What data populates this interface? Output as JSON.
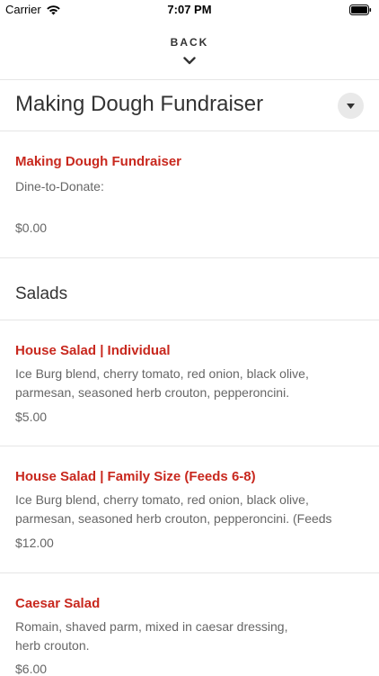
{
  "status_bar": {
    "carrier": "Carrier",
    "time": "7:07 PM"
  },
  "nav": {
    "back_label": "BACK"
  },
  "page": {
    "title": "Making Dough Fundraiser"
  },
  "fundraiser": {
    "name": "Making Dough Fundraiser",
    "description": "Dine-to-Donate:",
    "price": "$0.00"
  },
  "section": {
    "title": "Salads"
  },
  "menu_items": [
    {
      "name": "House Salad | Individual",
      "description": "Ice Burg blend, cherry tomato, red onion, black olive, parmesan, seasoned herb crouton, pepperoncini.",
      "price": "$5.00"
    },
    {
      "name": "House Salad | Family Size (Feeds 6-8)",
      "description": "Ice Burg blend, cherry tomato, red onion, black olive, parmesan, seasoned herb crouton, pepperoncini. (Feeds",
      "price": "$12.00"
    },
    {
      "name": "Caesar Salad",
      "description": "Romain, shaved parm, mixed in caesar dressing, herb crouton.",
      "price": "$6.00"
    }
  ],
  "colors": {
    "accent": "#c8281e",
    "text_primary": "#333333",
    "text_secondary": "#666666",
    "divider": "#e6e6e6"
  },
  "icons": {
    "wifi": "wifi-icon",
    "battery": "battery-icon",
    "back_chevron": "chevron-down-icon",
    "dropdown": "caret-down-icon"
  }
}
